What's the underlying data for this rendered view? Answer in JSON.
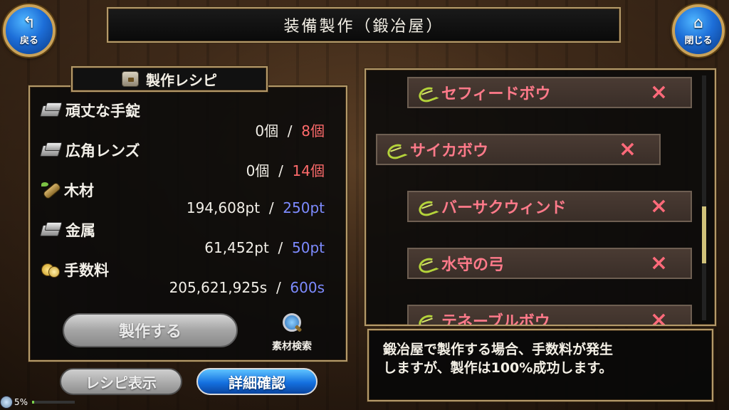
{
  "header": {
    "title": "装備製作（鍛冶屋）",
    "back_label": "戻る",
    "back_icon": "return-arrow-icon",
    "close_label": "閉じる",
    "close_icon": "home-icon"
  },
  "recipe": {
    "title": "製作レシピ",
    "materials": [
      {
        "name": "頑丈な手錠",
        "icon": "ingot-icon",
        "have": "0個",
        "sep": "/",
        "need": "8個",
        "need_color": "red"
      },
      {
        "name": "広角レンズ",
        "icon": "ingot-icon",
        "have": "0個",
        "sep": "/",
        "need": "14個",
        "need_color": "red"
      },
      {
        "name": "木材",
        "icon": "wood-icon",
        "have": "194,608pt",
        "sep": "/",
        "need": "250pt",
        "need_color": "blue"
      },
      {
        "name": "金属",
        "icon": "ingot-icon",
        "have": "61,452pt",
        "sep": "/",
        "need": "50pt",
        "need_color": "blue"
      },
      {
        "name": "手数料",
        "icon": "coin-icon",
        "have": "205,621,925s",
        "sep": "/",
        "need": "600s",
        "need_color": "blue"
      }
    ],
    "craft_button": "製作する",
    "search_label": "素材検索"
  },
  "bottom_buttons": {
    "recipe_display": "レシピ表示",
    "detail_confirm": "詳細確認"
  },
  "list": {
    "items": [
      {
        "name": "セフィードボウ",
        "mark": "×"
      },
      {
        "name": "サイカボウ",
        "mark": "×"
      },
      {
        "name": "バーサクウィンド",
        "mark": "×"
      },
      {
        "name": "水守の弓",
        "mark": "×"
      },
      {
        "name": "テネーブルボウ",
        "mark": "×"
      }
    ]
  },
  "message": {
    "line1": "鍛冶屋で製作する場合、手数料が発生",
    "line2": "しますが、製作は100%成功します。"
  },
  "status": {
    "percent": "5%",
    "progress": 0.05
  },
  "colors": {
    "accent_gold": "#b49a6a",
    "need_red": "#ff6b6b",
    "need_blue": "#7d8bff",
    "item_red": "#ff7a8a",
    "button_blue": "#1470e0"
  }
}
